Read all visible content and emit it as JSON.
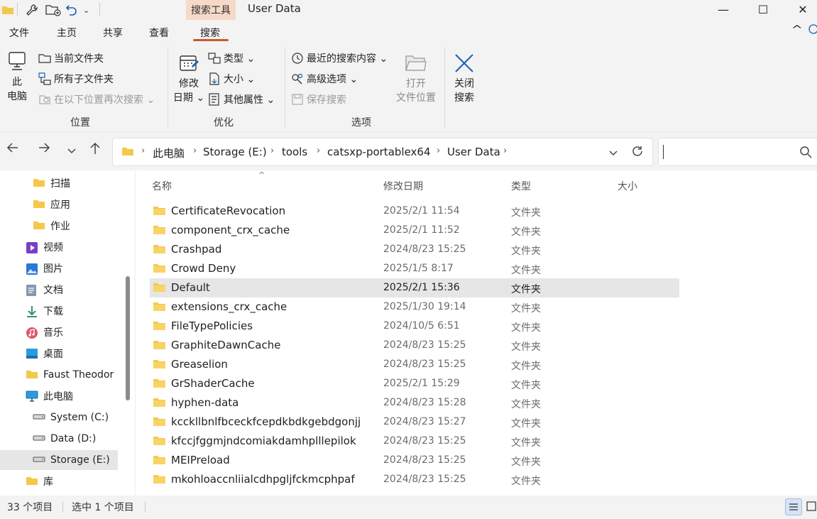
{
  "window": {
    "title": "User Data",
    "context_tab": "搜索工具",
    "controls": {
      "minimize": "—",
      "maximize": "☐",
      "close": "✕"
    }
  },
  "menu": {
    "tabs": [
      "文件",
      "主页",
      "共享",
      "查看",
      "搜索"
    ],
    "active": "搜索",
    "collapse_glyph": "^"
  },
  "ribbon": {
    "location": {
      "this_pc": "此\n电脑",
      "current_folder": "当前文件夹",
      "all_subfolders": "所有子文件夹",
      "search_again": "在以下位置再次搜索 ⌄",
      "group": "位置"
    },
    "refine": {
      "date_modified": "修改\n日期 ⌄",
      "kind": "类型 ⌄",
      "size": "大小 ⌄",
      "other_props": "其他属性 ⌄",
      "group": "优化"
    },
    "options": {
      "recent_searches": "最近的搜索内容 ⌄",
      "advanced": "高级选项 ⌄",
      "save_search": "保存搜索",
      "open_location": "打开\n文件位置",
      "group": "选项"
    },
    "close": {
      "label": "关闭\n搜索"
    }
  },
  "address": {
    "crumbs": [
      "此电脑",
      "Storage (E:)",
      "tools",
      "catsxp-portablex64",
      "User Data"
    ],
    "search_placeholder": ""
  },
  "sidebar": {
    "items": [
      {
        "label": "扫描",
        "icon": "folder-icon",
        "indent": 1
      },
      {
        "label": "应用",
        "icon": "folder-icon",
        "indent": 1
      },
      {
        "label": "作业",
        "icon": "folder-icon",
        "indent": 1
      },
      {
        "label": "视频",
        "icon": "video-icon",
        "indent": 0
      },
      {
        "label": "图片",
        "icon": "pictures-icon",
        "indent": 0
      },
      {
        "label": "文档",
        "icon": "documents-icon",
        "indent": 0
      },
      {
        "label": "下载",
        "icon": "download-icon",
        "indent": 0
      },
      {
        "label": "音乐",
        "icon": "music-icon",
        "indent": 0
      },
      {
        "label": "桌面",
        "icon": "desktop-icon",
        "indent": 0
      },
      {
        "label": "Faust Theodor",
        "icon": "folder-icon",
        "indent": 0
      },
      {
        "label": "此电脑",
        "icon": "pc-icon",
        "indent": 0
      },
      {
        "label": "System (C:)",
        "icon": "drive-icon",
        "indent": 1
      },
      {
        "label": "Data (D:)",
        "icon": "drive-icon",
        "indent": 1
      },
      {
        "label": "Storage (E:)",
        "icon": "drive-icon",
        "indent": 1,
        "selected": true
      },
      {
        "label": "库",
        "icon": "folder-icon",
        "indent": 0
      }
    ]
  },
  "columns": {
    "name": "名称",
    "date": "修改日期",
    "type": "类型",
    "size": "大小"
  },
  "files": [
    {
      "name": "CertificateRevocation",
      "date": "2025/2/1 11:54",
      "type": "文件夹"
    },
    {
      "name": "component_crx_cache",
      "date": "2025/2/1 11:52",
      "type": "文件夹"
    },
    {
      "name": "Crashpad",
      "date": "2024/8/23 15:25",
      "type": "文件夹"
    },
    {
      "name": "Crowd Deny",
      "date": "2025/1/5 8:17",
      "type": "文件夹"
    },
    {
      "name": "Default",
      "date": "2025/2/1 15:36",
      "type": "文件夹",
      "selected": true
    },
    {
      "name": "extensions_crx_cache",
      "date": "2025/1/30 19:14",
      "type": "文件夹"
    },
    {
      "name": "FileTypePolicies",
      "date": "2024/10/5 6:51",
      "type": "文件夹"
    },
    {
      "name": "GraphiteDawnCache",
      "date": "2024/8/23 15:25",
      "type": "文件夹"
    },
    {
      "name": "Greaselion",
      "date": "2024/8/23 15:25",
      "type": "文件夹"
    },
    {
      "name": "GrShaderCache",
      "date": "2025/2/1 15:29",
      "type": "文件夹"
    },
    {
      "name": "hyphen-data",
      "date": "2024/8/23 15:28",
      "type": "文件夹"
    },
    {
      "name": "kcckllbnlfbceckfcepdkbdkgebdgonjj",
      "date": "2024/8/23 15:27",
      "type": "文件夹"
    },
    {
      "name": "kfccjfggmjndcomiakdamhplllepilok",
      "date": "2024/8/23 15:25",
      "type": "文件夹"
    },
    {
      "name": "MEIPreload",
      "date": "2024/8/23 15:25",
      "type": "文件夹"
    },
    {
      "name": "mkohloaccnliialcdhpgljfckmcphpaf",
      "date": "2024/8/23 15:25",
      "type": "文件夹"
    }
  ],
  "status": {
    "count": "33 个项目",
    "selected": "选中 1 个项目"
  },
  "colors": {
    "accent": "#c75a2a",
    "context_tab_bg": "#f6d9c9",
    "folder": "#f4c84a",
    "selection": "#e6e6e6"
  }
}
